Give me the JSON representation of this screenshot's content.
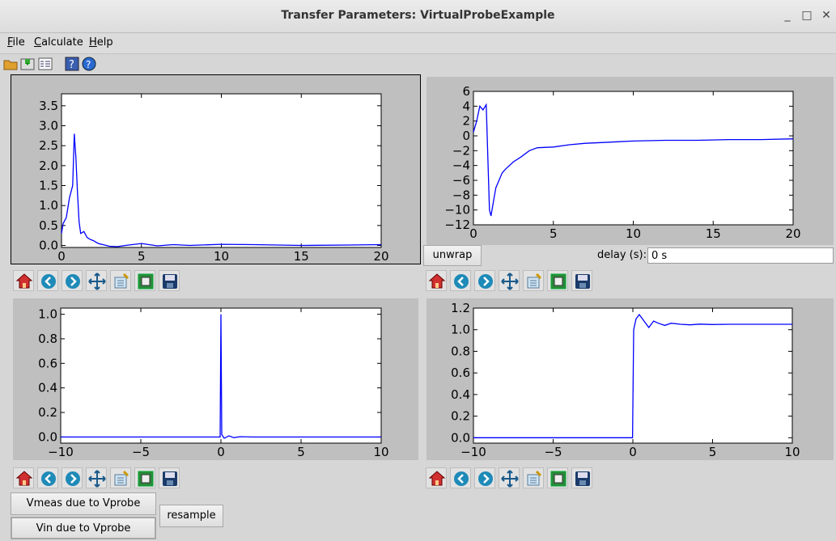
{
  "window": {
    "title": "Transfer Parameters: VirtualProbeExample",
    "minimize": "_",
    "maximize": "□",
    "close": "✕"
  },
  "menu": {
    "items": [
      {
        "label": "File"
      },
      {
        "label": "Calculate"
      },
      {
        "label": "Help"
      }
    ]
  },
  "toolbar": {
    "icons": [
      "open-file-icon",
      "save-icon",
      "properties-icon",
      "help-topic-icon",
      "help-icon"
    ]
  },
  "plots": {
    "top_left": {
      "chart_data": {
        "type": "line",
        "xlim": [
          0,
          20
        ],
        "ylim": [
          -0.05,
          3.8
        ],
        "x_ticks": [
          "0",
          "5",
          "10",
          "15",
          "20"
        ],
        "y_ticks": [
          "0.0",
          "0.5",
          "1.0",
          "1.5",
          "2.0",
          "2.5",
          "3.0",
          "3.5"
        ],
        "x": [
          0,
          0.1,
          0.3,
          0.5,
          0.7,
          0.8,
          0.9,
          1.0,
          1.1,
          1.2,
          1.4,
          1.6,
          1.8,
          2.0,
          2.3,
          2.6,
          3.0,
          3.5,
          4.0,
          5.0,
          6.0,
          7.0,
          8.0,
          10.0,
          12.0,
          15.0,
          18.0,
          20.0
        ],
        "y": [
          0.3,
          0.55,
          0.7,
          1.2,
          1.5,
          2.8,
          2.2,
          1.3,
          0.6,
          0.3,
          0.35,
          0.2,
          0.15,
          0.12,
          0.05,
          0.02,
          -0.02,
          -0.03,
          0.0,
          0.05,
          -0.01,
          0.02,
          0.0,
          0.03,
          0.02,
          0.0,
          0.01,
          0.02
        ]
      }
    },
    "top_right": {
      "chart_data": {
        "type": "line",
        "xlim": [
          0,
          20
        ],
        "ylim": [
          -12,
          6
        ],
        "x_ticks": [
          "0",
          "5",
          "10",
          "15",
          "20"
        ],
        "y_ticks": [
          "6",
          "4",
          "2",
          "0",
          "−2",
          "−4",
          "−6",
          "−8",
          "−10",
          "−12"
        ],
        "x": [
          0,
          0.2,
          0.4,
          0.6,
          0.8,
          1.0,
          1.1,
          1.2,
          1.4,
          1.6,
          1.8,
          2.0,
          2.5,
          3.0,
          3.5,
          4.0,
          5.0,
          6.0,
          7.0,
          8.0,
          9.0,
          10.0,
          12.0,
          14.0,
          16.0,
          18.0,
          20.0
        ],
        "y": [
          0.5,
          2.0,
          4.0,
          3.5,
          4.2,
          -10.0,
          -10.8,
          -9.5,
          -7.0,
          -6.0,
          -5.0,
          -4.5,
          -3.5,
          -2.8,
          -2.0,
          -1.6,
          -1.5,
          -1.2,
          -1.0,
          -0.9,
          -0.8,
          -0.7,
          -0.6,
          -0.6,
          -0.5,
          -0.5,
          -0.4
        ]
      }
    },
    "bottom_left": {
      "chart_data": {
        "type": "line",
        "xlim": [
          -10,
          10
        ],
        "ylim": [
          -0.05,
          1.05
        ],
        "x_ticks": [
          "−10",
          "−5",
          "0",
          "5",
          "10"
        ],
        "y_ticks": [
          "0.0",
          "0.2",
          "0.4",
          "0.6",
          "0.8",
          "1.0"
        ],
        "x": [
          -10,
          -0.05,
          0,
          0.05,
          0.2,
          0.5,
          0.8,
          1.2,
          2,
          3,
          5,
          10
        ],
        "y": [
          0,
          0,
          1.0,
          0.02,
          -0.01,
          0.01,
          -0.005,
          0.003,
          0,
          0,
          0,
          0
        ]
      }
    },
    "bottom_right": {
      "chart_data": {
        "type": "line",
        "xlim": [
          -10,
          10
        ],
        "ylim": [
          -0.05,
          1.2
        ],
        "x_ticks": [
          "−10",
          "−5",
          "0",
          "5",
          "10"
        ],
        "y_ticks": [
          "0.0",
          "0.2",
          "0.4",
          "0.6",
          "0.8",
          "1.0",
          "1.2"
        ],
        "x": [
          -10,
          -0.02,
          0.05,
          0.2,
          0.4,
          0.7,
          1.0,
          1.3,
          1.6,
          2.0,
          2.4,
          3.0,
          3.6,
          4.2,
          5.0,
          6.0,
          8.0,
          10.0
        ],
        "y": [
          0,
          0,
          1.0,
          1.1,
          1.14,
          1.08,
          1.02,
          1.08,
          1.06,
          1.04,
          1.06,
          1.05,
          1.045,
          1.052,
          1.048,
          1.05,
          1.05,
          1.05
        ]
      }
    }
  },
  "controls": {
    "unwrap_label": "unwrap",
    "delay_label": "delay (s):",
    "delay_value": "0 s",
    "vmeas_label": "Vmeas due to Vprobe",
    "vin_label": "Vin due to Vprobe",
    "resample_label": "resample"
  },
  "colors": {
    "line": "#0000ff",
    "panel": "#bfbfbf"
  }
}
